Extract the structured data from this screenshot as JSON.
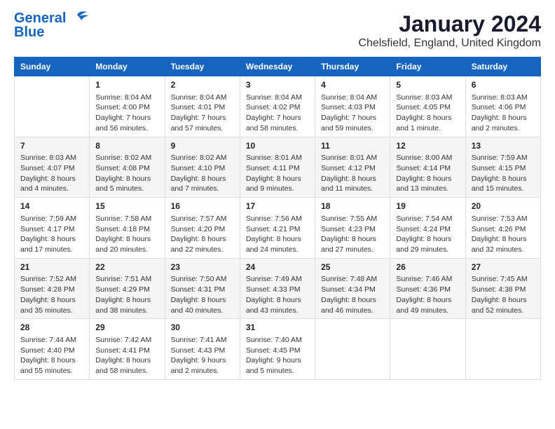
{
  "logo": {
    "line1": "General",
    "line2": "Blue"
  },
  "header": {
    "month": "January 2024",
    "location": "Chelsfield, England, United Kingdom"
  },
  "weekdays": [
    "Sunday",
    "Monday",
    "Tuesday",
    "Wednesday",
    "Thursday",
    "Friday",
    "Saturday"
  ],
  "rows": [
    [
      {
        "day": "",
        "lines": []
      },
      {
        "day": "1",
        "lines": [
          "Sunrise: 8:04 AM",
          "Sunset: 4:00 PM",
          "Daylight: 7 hours",
          "and 56 minutes."
        ]
      },
      {
        "day": "2",
        "lines": [
          "Sunrise: 8:04 AM",
          "Sunset: 4:01 PM",
          "Daylight: 7 hours",
          "and 57 minutes."
        ]
      },
      {
        "day": "3",
        "lines": [
          "Sunrise: 8:04 AM",
          "Sunset: 4:02 PM",
          "Daylight: 7 hours",
          "and 58 minutes."
        ]
      },
      {
        "day": "4",
        "lines": [
          "Sunrise: 8:04 AM",
          "Sunset: 4:03 PM",
          "Daylight: 7 hours",
          "and 59 minutes."
        ]
      },
      {
        "day": "5",
        "lines": [
          "Sunrise: 8:03 AM",
          "Sunset: 4:05 PM",
          "Daylight: 8 hours",
          "and 1 minute."
        ]
      },
      {
        "day": "6",
        "lines": [
          "Sunrise: 8:03 AM",
          "Sunset: 4:06 PM",
          "Daylight: 8 hours",
          "and 2 minutes."
        ]
      }
    ],
    [
      {
        "day": "7",
        "lines": [
          "Sunrise: 8:03 AM",
          "Sunset: 4:07 PM",
          "Daylight: 8 hours",
          "and 4 minutes."
        ]
      },
      {
        "day": "8",
        "lines": [
          "Sunrise: 8:02 AM",
          "Sunset: 4:08 PM",
          "Daylight: 8 hours",
          "and 5 minutes."
        ]
      },
      {
        "day": "9",
        "lines": [
          "Sunrise: 8:02 AM",
          "Sunset: 4:10 PM",
          "Daylight: 8 hours",
          "and 7 minutes."
        ]
      },
      {
        "day": "10",
        "lines": [
          "Sunrise: 8:01 AM",
          "Sunset: 4:11 PM",
          "Daylight: 8 hours",
          "and 9 minutes."
        ]
      },
      {
        "day": "11",
        "lines": [
          "Sunrise: 8:01 AM",
          "Sunset: 4:12 PM",
          "Daylight: 8 hours",
          "and 11 minutes."
        ]
      },
      {
        "day": "12",
        "lines": [
          "Sunrise: 8:00 AM",
          "Sunset: 4:14 PM",
          "Daylight: 8 hours",
          "and 13 minutes."
        ]
      },
      {
        "day": "13",
        "lines": [
          "Sunrise: 7:59 AM",
          "Sunset: 4:15 PM",
          "Daylight: 8 hours",
          "and 15 minutes."
        ]
      }
    ],
    [
      {
        "day": "14",
        "lines": [
          "Sunrise: 7:59 AM",
          "Sunset: 4:17 PM",
          "Daylight: 8 hours",
          "and 17 minutes."
        ]
      },
      {
        "day": "15",
        "lines": [
          "Sunrise: 7:58 AM",
          "Sunset: 4:18 PM",
          "Daylight: 8 hours",
          "and 20 minutes."
        ]
      },
      {
        "day": "16",
        "lines": [
          "Sunrise: 7:57 AM",
          "Sunset: 4:20 PM",
          "Daylight: 8 hours",
          "and 22 minutes."
        ]
      },
      {
        "day": "17",
        "lines": [
          "Sunrise: 7:56 AM",
          "Sunset: 4:21 PM",
          "Daylight: 8 hours",
          "and 24 minutes."
        ]
      },
      {
        "day": "18",
        "lines": [
          "Sunrise: 7:55 AM",
          "Sunset: 4:23 PM",
          "Daylight: 8 hours",
          "and 27 minutes."
        ]
      },
      {
        "day": "19",
        "lines": [
          "Sunrise: 7:54 AM",
          "Sunset: 4:24 PM",
          "Daylight: 8 hours",
          "and 29 minutes."
        ]
      },
      {
        "day": "20",
        "lines": [
          "Sunrise: 7:53 AM",
          "Sunset: 4:26 PM",
          "Daylight: 8 hours",
          "and 32 minutes."
        ]
      }
    ],
    [
      {
        "day": "21",
        "lines": [
          "Sunrise: 7:52 AM",
          "Sunset: 4:28 PM",
          "Daylight: 8 hours",
          "and 35 minutes."
        ]
      },
      {
        "day": "22",
        "lines": [
          "Sunrise: 7:51 AM",
          "Sunset: 4:29 PM",
          "Daylight: 8 hours",
          "and 38 minutes."
        ]
      },
      {
        "day": "23",
        "lines": [
          "Sunrise: 7:50 AM",
          "Sunset: 4:31 PM",
          "Daylight: 8 hours",
          "and 40 minutes."
        ]
      },
      {
        "day": "24",
        "lines": [
          "Sunrise: 7:49 AM",
          "Sunset: 4:33 PM",
          "Daylight: 8 hours",
          "and 43 minutes."
        ]
      },
      {
        "day": "25",
        "lines": [
          "Sunrise: 7:48 AM",
          "Sunset: 4:34 PM",
          "Daylight: 8 hours",
          "and 46 minutes."
        ]
      },
      {
        "day": "26",
        "lines": [
          "Sunrise: 7:46 AM",
          "Sunset: 4:36 PM",
          "Daylight: 8 hours",
          "and 49 minutes."
        ]
      },
      {
        "day": "27",
        "lines": [
          "Sunrise: 7:45 AM",
          "Sunset: 4:38 PM",
          "Daylight: 8 hours",
          "and 52 minutes."
        ]
      }
    ],
    [
      {
        "day": "28",
        "lines": [
          "Sunrise: 7:44 AM",
          "Sunset: 4:40 PM",
          "Daylight: 8 hours",
          "and 55 minutes."
        ]
      },
      {
        "day": "29",
        "lines": [
          "Sunrise: 7:42 AM",
          "Sunset: 4:41 PM",
          "Daylight: 8 hours",
          "and 58 minutes."
        ]
      },
      {
        "day": "30",
        "lines": [
          "Sunrise: 7:41 AM",
          "Sunset: 4:43 PM",
          "Daylight: 9 hours",
          "and 2 minutes."
        ]
      },
      {
        "day": "31",
        "lines": [
          "Sunrise: 7:40 AM",
          "Sunset: 4:45 PM",
          "Daylight: 9 hours",
          "and 5 minutes."
        ]
      },
      {
        "day": "",
        "lines": []
      },
      {
        "day": "",
        "lines": []
      },
      {
        "day": "",
        "lines": []
      }
    ]
  ]
}
